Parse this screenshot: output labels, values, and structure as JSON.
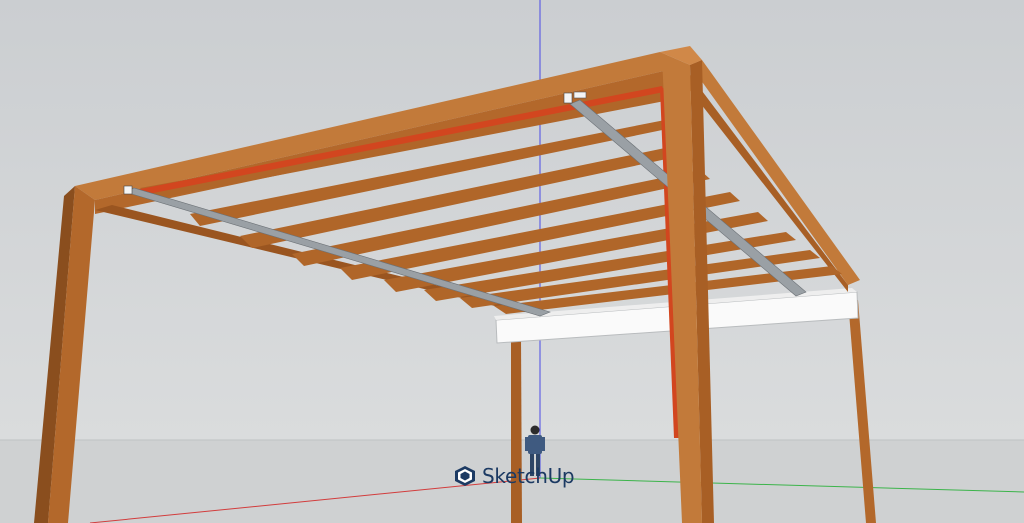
{
  "app": {
    "brand": "SketchUp",
    "logo_icon": "sketchup-logo-icon"
  },
  "colors": {
    "sky": "#d6d8da",
    "ground": "#cdcfd0",
    "wood": "#b3682b",
    "wood_light": "#c9813e",
    "wood_dark": "#8a4e1e",
    "steel_red": "#d2461f",
    "rail": "#9aa0a5",
    "fascia": "#fafafa",
    "axis_blue": "#4a4ae6",
    "axis_red": "#d23c3c",
    "axis_green": "#3cb44b",
    "brand_text": "#1c3a63"
  },
  "scene": {
    "model": "pergola",
    "figure": "scale-person"
  }
}
